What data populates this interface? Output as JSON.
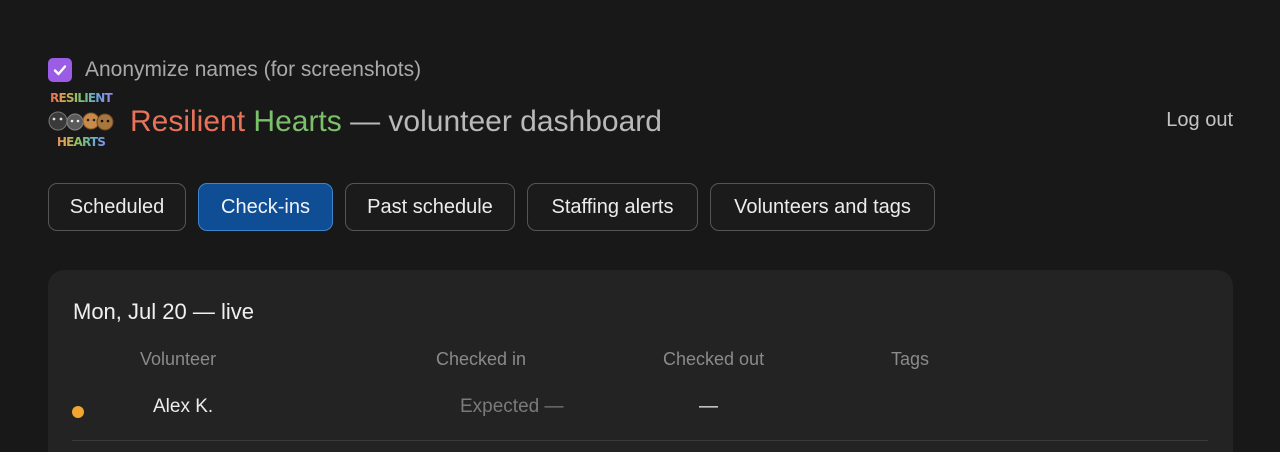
{
  "anonymize": {
    "label": "Anonymize names (for screenshots)",
    "checked": true,
    "color": "#9b5de5"
  },
  "logo": {
    "top_text": "RESILIENT",
    "bottom_text": "HEARTS"
  },
  "header": {
    "title_word1": "Resilient",
    "title_word2": "Hearts",
    "title_rest": " — volunteer dashboard",
    "logout_label": "Log out"
  },
  "tabs": [
    {
      "label": "Scheduled",
      "active": false
    },
    {
      "label": "Check-ins",
      "active": true
    },
    {
      "label": "Past schedule",
      "active": false
    },
    {
      "label": "Staffing alerts",
      "active": false
    },
    {
      "label": "Volunteers and tags",
      "active": false
    }
  ],
  "accent_color": "#0f4d94",
  "checkins": {
    "title": "Mon, Jul 20 — live",
    "columns": [
      "Volunteer",
      "Checked in",
      "Checked out",
      "Tags"
    ],
    "rows": [
      {
        "status": "expected",
        "status_color": "#f0a630",
        "volunteer": "Alex K.",
        "checked_in": "Expected —",
        "checked_out": "—",
        "tags": ""
      }
    ]
  }
}
